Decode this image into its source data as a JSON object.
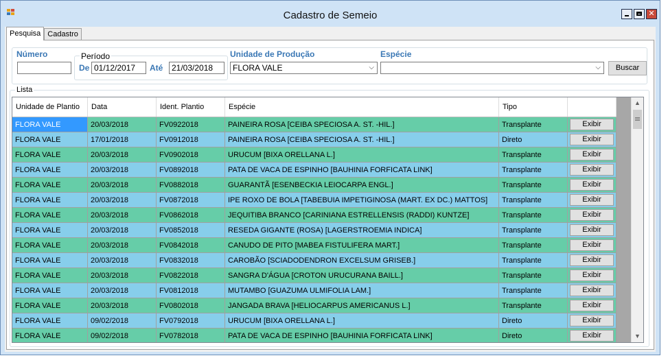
{
  "window": {
    "title": "Cadastro de Semeio"
  },
  "tabs": [
    {
      "label": "Pesquisa"
    },
    {
      "label": "Cadastro"
    }
  ],
  "filters": {
    "numero_label": "Número",
    "numero_value": "",
    "periodo_label": "Período",
    "de_label": "De",
    "de_value": "01/12/2017",
    "ate_label": "Até",
    "ate_value": "21/03/2018",
    "unidade_label": "Unidade de Produção",
    "unidade_value": "FLORA VALE",
    "especie_label": "Espécie",
    "especie_value": "",
    "buscar_label": "Buscar"
  },
  "lista": {
    "label": "Lista",
    "columns": [
      "Unidade de Plantio",
      "Data",
      "Ident. Plantio",
      "Espécie",
      "Tipo",
      ""
    ],
    "button_label": "Exibir",
    "rows": [
      {
        "unidade": "FLORA VALE",
        "data": "20/03/2018",
        "ident": "FV0922018",
        "especie": "PAINEIRA ROSA [CEIBA SPECIOSA  A. ST. -HIL.]",
        "tipo": "Transplante"
      },
      {
        "unidade": "FLORA VALE",
        "data": "17/01/2018",
        "ident": "FV0912018",
        "especie": "PAINEIRA ROSA [CEIBA SPECIOSA  A. ST. -HIL.]",
        "tipo": "Direto"
      },
      {
        "unidade": "FLORA VALE",
        "data": "20/03/2018",
        "ident": "FV0902018",
        "especie": "URUCUM [BIXA ORELLANA  L.]",
        "tipo": "Transplante"
      },
      {
        "unidade": "FLORA VALE",
        "data": "20/03/2018",
        "ident": "FV0892018",
        "especie": "PATA DE VACA DE ESPINHO [BAUHINIA FORFICATA  LINK]",
        "tipo": "Transplante"
      },
      {
        "unidade": "FLORA VALE",
        "data": "20/03/2018",
        "ident": "FV0882018",
        "especie": "GUARANTÃ [ESENBECKIA LEIOCARPA  ENGL.]",
        "tipo": "Transplante"
      },
      {
        "unidade": "FLORA VALE",
        "data": "20/03/2018",
        "ident": "FV0872018",
        "especie": "IPE ROXO DE BOLA [TABEBUIA IMPETIGINOSA  (MART. EX DC.) MATTOS]",
        "tipo": "Transplante"
      },
      {
        "unidade": "FLORA VALE",
        "data": "20/03/2018",
        "ident": "FV0862018",
        "especie": "JEQUITIBA BRANCO [CARINIANA ESTRELLENSIS  (RADDI) KUNTZE]",
        "tipo": "Transplante"
      },
      {
        "unidade": "FLORA VALE",
        "data": "20/03/2018",
        "ident": "FV0852018",
        "especie": "RESEDA GIGANTE (ROSA) [LAGERSTROEMIA INDICA]",
        "tipo": "Transplante"
      },
      {
        "unidade": "FLORA VALE",
        "data": "20/03/2018",
        "ident": "FV0842018",
        "especie": "CANUDO DE PITO [MABEA FISTULIFERA  MART.]",
        "tipo": "Transplante"
      },
      {
        "unidade": "FLORA VALE",
        "data": "20/03/2018",
        "ident": "FV0832018",
        "especie": "CAROBÃO [SCIADODENDRON EXCELSUM  GRISEB.]",
        "tipo": "Transplante"
      },
      {
        "unidade": "FLORA VALE",
        "data": "20/03/2018",
        "ident": "FV0822018",
        "especie": "SANGRA D'ÁGUA [CROTON URUCURANA  BAILL.]",
        "tipo": "Transplante"
      },
      {
        "unidade": "FLORA VALE",
        "data": "20/03/2018",
        "ident": "FV0812018",
        "especie": "MUTAMBO [GUAZUMA ULMIFOLIA  LAM.]",
        "tipo": "Transplante"
      },
      {
        "unidade": "FLORA VALE",
        "data": "20/03/2018",
        "ident": "FV0802018",
        "especie": "JANGADA BRAVA [HELIOCARPUS AMERICANUS  L.]",
        "tipo": "Transplante"
      },
      {
        "unidade": "FLORA VALE",
        "data": "09/02/2018",
        "ident": "FV0792018",
        "especie": "URUCUM [BIXA ORELLANA  L.]",
        "tipo": "Direto"
      },
      {
        "unidade": "FLORA VALE",
        "data": "09/02/2018",
        "ident": "FV0782018",
        "especie": "PATA DE VACA DE ESPINHO [BAUHINIA FORFICATA  LINK]",
        "tipo": "Direto"
      }
    ]
  },
  "colors": {
    "row_green": "#66cda8",
    "row_blue": "#87ceeb",
    "selection": "#3399ff",
    "label_blue": "#3b78b5"
  }
}
